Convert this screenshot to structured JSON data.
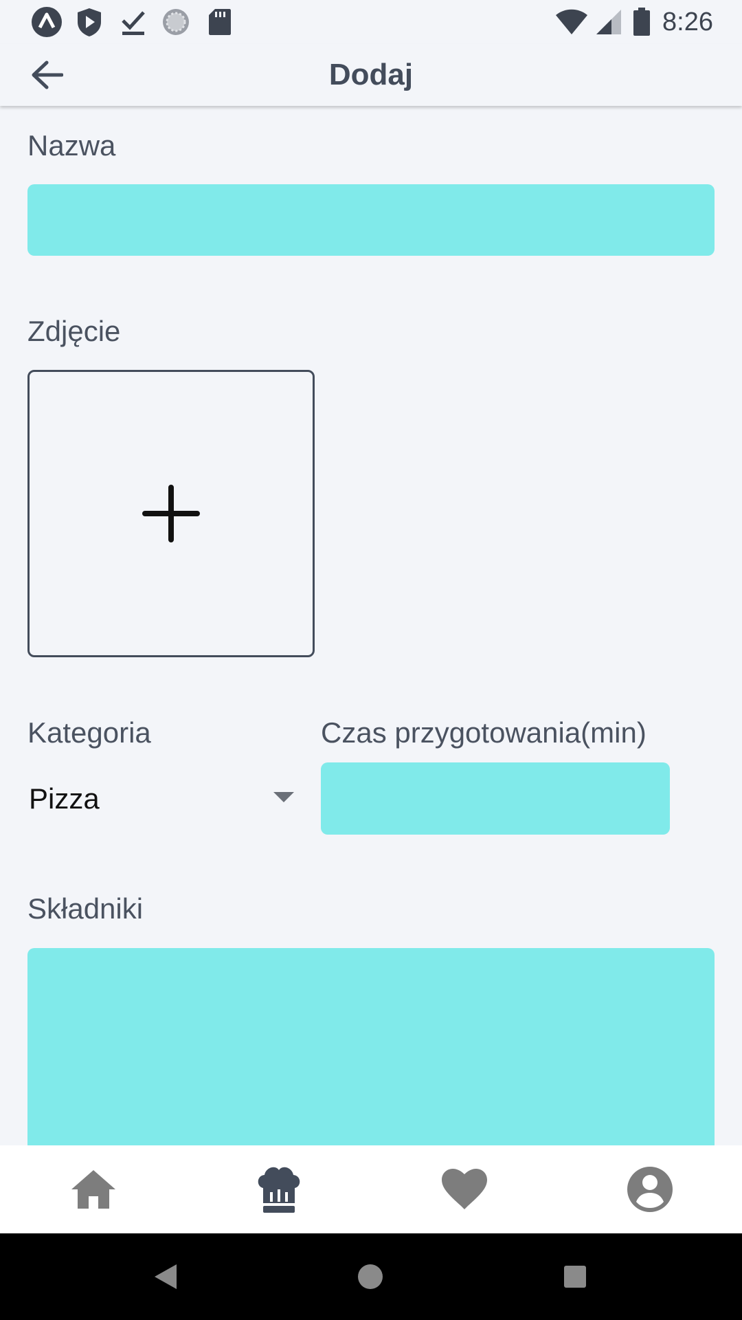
{
  "status_bar": {
    "time": "8:26",
    "left_icons": [
      "app-a-icon",
      "shield-play-icon",
      "download-done-icon",
      "sync-circle-icon",
      "sd-card-icon"
    ],
    "right_icons": [
      "wifi-icon",
      "cell-signal-icon",
      "battery-icon"
    ]
  },
  "app_bar": {
    "title": "Dodaj",
    "back_icon": "arrow-back-icon"
  },
  "form": {
    "name": {
      "label": "Nazwa",
      "value": "",
      "placeholder": ""
    },
    "photo": {
      "label": "Zdjęcie",
      "add_icon": "plus-icon"
    },
    "category": {
      "label": "Kategoria",
      "selected": "Pizza"
    },
    "prep_time": {
      "label": "Czas przygotowania(min)",
      "value": "",
      "placeholder": ""
    },
    "ingredients": {
      "label": "Składniki",
      "value": "",
      "placeholder": ""
    }
  },
  "bottom_nav": {
    "items": [
      {
        "id": "home",
        "icon": "home-icon"
      },
      {
        "id": "recipes",
        "icon": "chef-hat-icon"
      },
      {
        "id": "favorites",
        "icon": "heart-icon"
      },
      {
        "id": "profile",
        "icon": "account-circle-icon"
      }
    ]
  },
  "colors": {
    "background": "#f3f5f9",
    "field": "#80eaea",
    "text": "#434c5b",
    "nav_inactive": "#7d7d7d",
    "nav_active": "#434c5b"
  }
}
